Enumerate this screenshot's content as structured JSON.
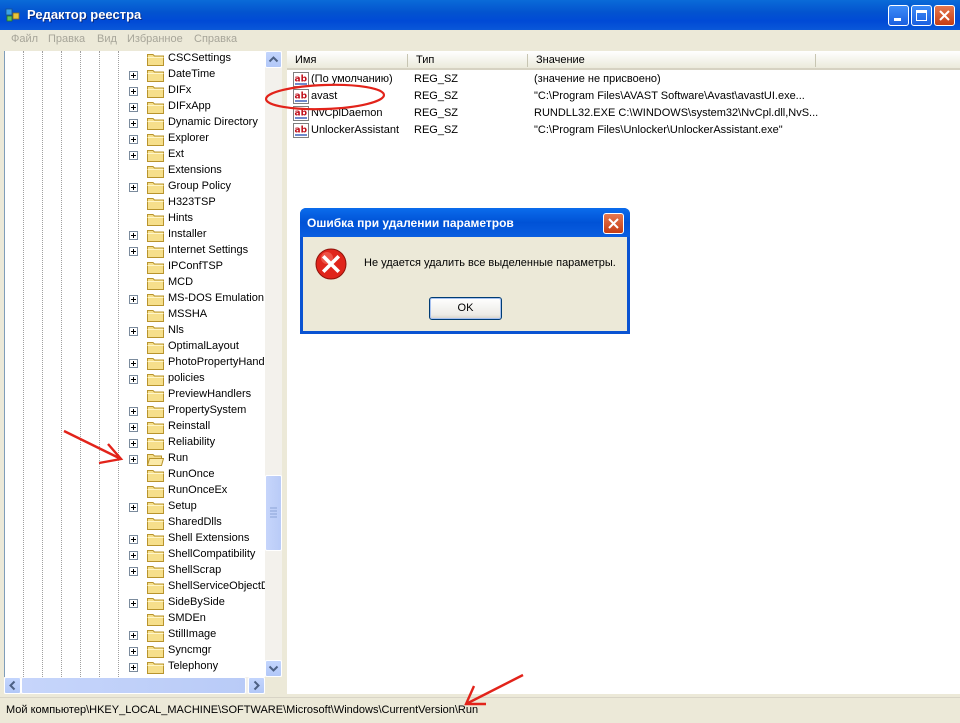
{
  "window": {
    "title": "Редактор реестра"
  },
  "icons": {
    "app": "regedit-icon",
    "minimize": "minimize-icon",
    "maximize": "maximize-icon",
    "close": "close-icon",
    "folder": "folder-icon",
    "expander": "plus-expander-icon",
    "string_value": "ab-string-value-icon",
    "error": "error-icon",
    "scroll_up": "arrow-up-icon",
    "scroll_down": "arrow-down-icon",
    "scroll_left": "arrow-left-icon",
    "scroll_right": "arrow-right-icon"
  },
  "colors": {
    "titlebar": "#0054e3",
    "error_icon": "#e0251b",
    "annotation_red": "#e2231a",
    "selection_border": "#000000"
  },
  "menu": [
    {
      "label": "Файл"
    },
    {
      "label": "Правка"
    },
    {
      "label": "Вид"
    },
    {
      "label": "Избранное"
    },
    {
      "label": "Справка"
    }
  ],
  "tree": {
    "items": [
      {
        "label": "CSCSettings",
        "expandable": false
      },
      {
        "label": "DateTime",
        "expandable": true
      },
      {
        "label": "DIFx",
        "expandable": true
      },
      {
        "label": "DIFxApp",
        "expandable": true
      },
      {
        "label": "Dynamic Directory",
        "expandable": true
      },
      {
        "label": "Explorer",
        "expandable": true
      },
      {
        "label": "Ext",
        "expandable": true
      },
      {
        "label": "Extensions",
        "expandable": false
      },
      {
        "label": "Group Policy",
        "expandable": true
      },
      {
        "label": "H323TSP",
        "expandable": false
      },
      {
        "label": "Hints",
        "expandable": false
      },
      {
        "label": "Installer",
        "expandable": true
      },
      {
        "label": "Internet Settings",
        "expandable": true
      },
      {
        "label": "IPConfTSP",
        "expandable": false
      },
      {
        "label": "MCD",
        "expandable": false
      },
      {
        "label": "MS-DOS Emulation",
        "expandable": true
      },
      {
        "label": "MSSHA",
        "expandable": false
      },
      {
        "label": "Nls",
        "expandable": true
      },
      {
        "label": "OptimalLayout",
        "expandable": false
      },
      {
        "label": "PhotoPropertyHandle",
        "expandable": true
      },
      {
        "label": "policies",
        "expandable": true
      },
      {
        "label": "PreviewHandlers",
        "expandable": false
      },
      {
        "label": "PropertySystem",
        "expandable": true
      },
      {
        "label": "Reinstall",
        "expandable": true
      },
      {
        "label": "Reliability",
        "expandable": true
      },
      {
        "label": "Run",
        "expandable": true,
        "selected": true
      },
      {
        "label": "RunOnce",
        "expandable": false
      },
      {
        "label": "RunOnceEx",
        "expandable": false
      },
      {
        "label": "Setup",
        "expandable": true
      },
      {
        "label": "SharedDlls",
        "expandable": false
      },
      {
        "label": "Shell Extensions",
        "expandable": true
      },
      {
        "label": "ShellCompatibility",
        "expandable": true
      },
      {
        "label": "ShellScrap",
        "expandable": true
      },
      {
        "label": "ShellServiceObjectDe",
        "expandable": false
      },
      {
        "label": "SideBySide",
        "expandable": true
      },
      {
        "label": "SMDEn",
        "expandable": false
      },
      {
        "label": "StillImage",
        "expandable": true
      },
      {
        "label": "Syncmgr",
        "expandable": true
      },
      {
        "label": "Telephony",
        "expandable": true
      }
    ]
  },
  "list": {
    "columns": [
      {
        "label": "Имя"
      },
      {
        "label": "Тип"
      },
      {
        "label": "Значение"
      }
    ],
    "rows": [
      {
        "name": "(По умолчанию)",
        "type": "REG_SZ",
        "value": "(значение не присвоено)"
      },
      {
        "name": "avast",
        "type": "REG_SZ",
        "value": "\"C:\\Program Files\\AVAST Software\\Avast\\avastUI.exe..."
      },
      {
        "name": "NvCplDaemon",
        "type": "REG_SZ",
        "value": "RUNDLL32.EXE C:\\WINDOWS\\system32\\NvCpl.dll,NvS..."
      },
      {
        "name": "UnlockerAssistant",
        "type": "REG_SZ",
        "value": "\"C:\\Program Files\\Unlocker\\UnlockerAssistant.exe\""
      }
    ]
  },
  "dialog": {
    "title": "Ошибка при удалении параметров",
    "message": "Не удается удалить все выделенные параметры.",
    "ok_label": "OK"
  },
  "statusbar": {
    "path": "Мой компьютер\\HKEY_LOCAL_MACHINE\\SOFTWARE\\Microsoft\\Windows\\CurrentVersion\\Run"
  }
}
